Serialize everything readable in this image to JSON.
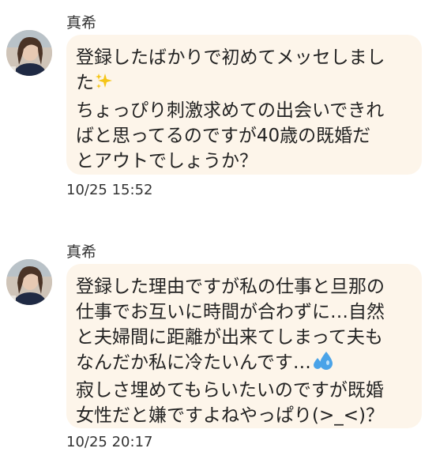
{
  "messages": [
    {
      "sender": "真希",
      "lines": [
        "登録したばかりで初めてメッセしまし",
        "た",
        "ちょっぴり刺激求めての出会いできれ",
        "ばと思ってるのですが40歳の既婚だ",
        "とアウトでしょうか？"
      ],
      "emoji": "sparkles-icon",
      "time": "10/25 15:52"
    },
    {
      "sender": "真希",
      "lines": [
        "登録した理由ですが私の仕事と旦那の",
        "仕事でお互いに時間が合わずに…自然",
        "と夫婦間に距離が出来てしまって夫も",
        "なんだか私に冷たいんです…",
        "寂しさ埋めてもらいたいのですが既婚",
        "女性だと嫌ですよねやっぱり(>_<)？"
      ],
      "emoji": "sweat-droplets-icon",
      "time": "10/25 20:17"
    }
  ],
  "colors": {
    "bubble": "#fdf5ea",
    "text": "#222222",
    "sparkle": "#f5c518",
    "droplet": "#4aa3e8"
  }
}
